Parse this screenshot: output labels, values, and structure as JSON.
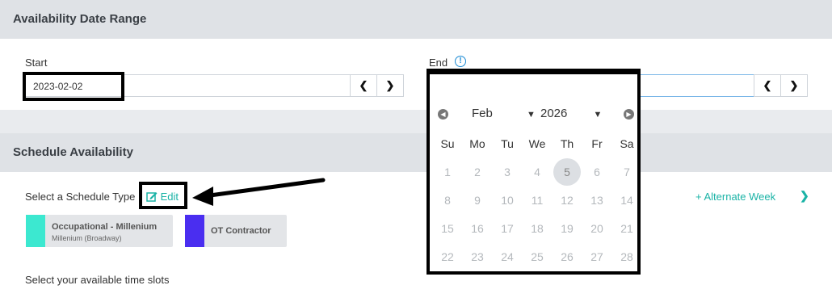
{
  "date_range": {
    "title": "Availability Date Range",
    "start_label": "Start",
    "start_value": "2023-02-02",
    "end_label": "End",
    "end_value": "----‑--‑--",
    "prev_symbol": "❮",
    "next_symbol": "❯",
    "info_symbol": "!"
  },
  "calendar": {
    "month": "Feb",
    "year": "2026",
    "days_of_week": [
      "Su",
      "Mo",
      "Tu",
      "We",
      "Th",
      "Fr",
      "Sa"
    ],
    "weeks": [
      [
        "1",
        "2",
        "3",
        "4",
        "5",
        "6",
        "7"
      ],
      [
        "8",
        "9",
        "10",
        "11",
        "12",
        "13",
        "14"
      ],
      [
        "15",
        "16",
        "17",
        "18",
        "19",
        "20",
        "21"
      ],
      [
        "22",
        "23",
        "24",
        "25",
        "26",
        "27",
        "28"
      ]
    ],
    "highlighted_day": "5"
  },
  "schedule": {
    "title": "Schedule Availability",
    "select_type_label": "Select a Schedule Type",
    "edit_label": "Edit",
    "alternate_week_label": "+ Alternate Week",
    "types": [
      {
        "name": "Occupational - Millenium",
        "subtitle": "Millenium (Broadway)",
        "color": "#3ce8d0"
      },
      {
        "name": "OT Contractor",
        "subtitle": "",
        "color": "#4a2ef0"
      }
    ],
    "time_slots_label": "Select your available time slots"
  }
}
